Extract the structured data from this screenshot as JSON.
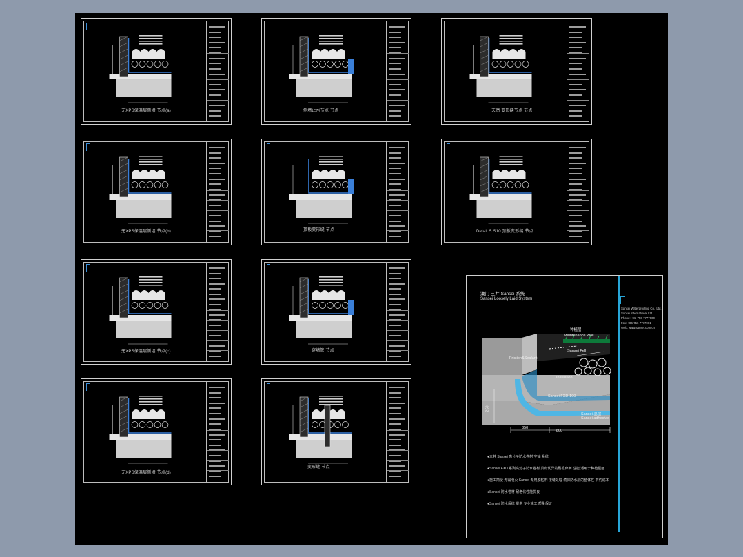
{
  "sheets": [
    {
      "id": "s1",
      "caption": "无XPS保温层侧墙 节点(a)"
    },
    {
      "id": "s2",
      "caption": "侧墙止水节点 节点"
    },
    {
      "id": "s3",
      "caption": "天然 变形缝节点 节点"
    },
    {
      "id": "s4",
      "caption": "无XPS保温层侧墙 节点(b)"
    },
    {
      "id": "s5",
      "caption": "顶板变形缝 节点"
    },
    {
      "id": "s6",
      "caption": "Detail S.S10 顶板变形缝 节点"
    },
    {
      "id": "s7",
      "caption": "无XPS保温层侧墙 节点(c)"
    },
    {
      "id": "s8",
      "caption": "穿墙管 节点"
    },
    {
      "id": "s9",
      "caption": "无XPS保温层侧墙 节点(d)"
    },
    {
      "id": "s10",
      "caption": "变形缝 节点"
    }
  ],
  "poster": {
    "title": "澳门 三井 Sansei 系统",
    "subtitle": "Sansei Loosely Laid System",
    "contact": [
      "Sansei Waterproofing Co., Ltd.",
      "Sansei International Ltd.",
      "Phone: +86-756-7777000",
      "Fax: +86-756-7777001",
      "Web: www.sansei.com.cn"
    ],
    "labels": {
      "top": "种植层",
      "maintenance": "Maintenance Wall",
      "friction": "Friction&Sealant",
      "sansei_fell": "Sansei Fell",
      "insulation": "Insulation",
      "fxd": "Sansei FXD-100",
      "base": "Sansei 基层",
      "adhesive": "Sansei adhesive",
      "dim250": "250",
      "dim350": "350",
      "dim800": "800"
    },
    "notes": [
      "●三井 Sansei 高分子防水卷材 空铺 系统",
      "●Sansei FXD 系列高分子防水卷材 具有优异的耐根穿刺 性能 适用于种植屋面",
      "●施工简便 无需明火 Sansei 专用胶粘剂 接缝处理 确保防水层的整体性 节约成本",
      "●Sansei 防水卷材 耐老化性能优良",
      "●Sansei 防水系统 提供 专业施工 质量保证"
    ]
  }
}
